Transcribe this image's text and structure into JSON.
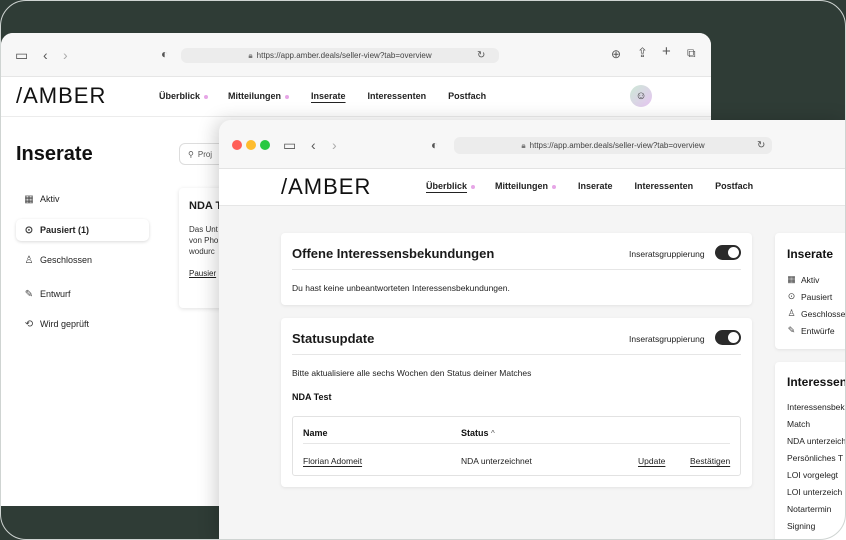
{
  "browser": {
    "url": "https://app.amber.deals/seller-view?tab=overview"
  },
  "brand": {
    "logo": "/AMBER"
  },
  "nav": {
    "items": [
      {
        "label": "Überblick"
      },
      {
        "label": "Mitteilungen"
      },
      {
        "label": "Inserate"
      },
      {
        "label": "Interessenten"
      },
      {
        "label": "Postfach"
      }
    ]
  },
  "back": {
    "page_title": "Inserate",
    "search_placeholder": "Proj",
    "sidebar": [
      {
        "label": "Aktiv",
        "icon": "building-icon"
      },
      {
        "label": "Pausiert (1)",
        "icon": "pause-icon"
      },
      {
        "label": "Geschlossen",
        "icon": "people-icon"
      },
      {
        "label": "Entwurf",
        "icon": "edit-icon"
      },
      {
        "label": "Wird geprüft",
        "icon": "review-icon"
      }
    ],
    "card": {
      "title": "NDA T",
      "line1": "Das Unt",
      "line2": "von Pho",
      "line3": "wodurc",
      "link": "Pausier"
    }
  },
  "front": {
    "interest_card": {
      "title": "Offene Interessensbekundungen",
      "toggle_label": "Inseratsgruppierung",
      "empty_text": "Du hast keine unbeantworteten Interessensbekundungen."
    },
    "status_card": {
      "title": "Statusupdate",
      "toggle_label": "Inseratsgruppierung",
      "hint": "Bitte aktualisiere alle sechs Wochen den Status deiner Matches",
      "group_title": "NDA Test",
      "table": {
        "col_name": "Name",
        "col_status": "Status",
        "sort_icon": "^",
        "rows": [
          {
            "name": "Florian Adomeit",
            "status": "NDA unterzeichnet",
            "action1": "Update",
            "action2": "Bestätigen"
          }
        ]
      }
    },
    "right_inserate": {
      "title": "Inserate",
      "items": [
        {
          "label": "Aktiv",
          "icon": "building-icon"
        },
        {
          "label": "Pausiert",
          "icon": "pause-icon"
        },
        {
          "label": "Geschlosse",
          "icon": "people-icon"
        },
        {
          "label": "Entwürfe",
          "icon": "edit-icon"
        }
      ]
    },
    "right_interessenten": {
      "title": "Interessen",
      "items": [
        "Interessensbek",
        "Match",
        "NDA unterzeich",
        "Persönliches T",
        "LOI vorgelegt",
        "LOI unterzeich",
        "Notartermin",
        "Signing"
      ]
    }
  }
}
